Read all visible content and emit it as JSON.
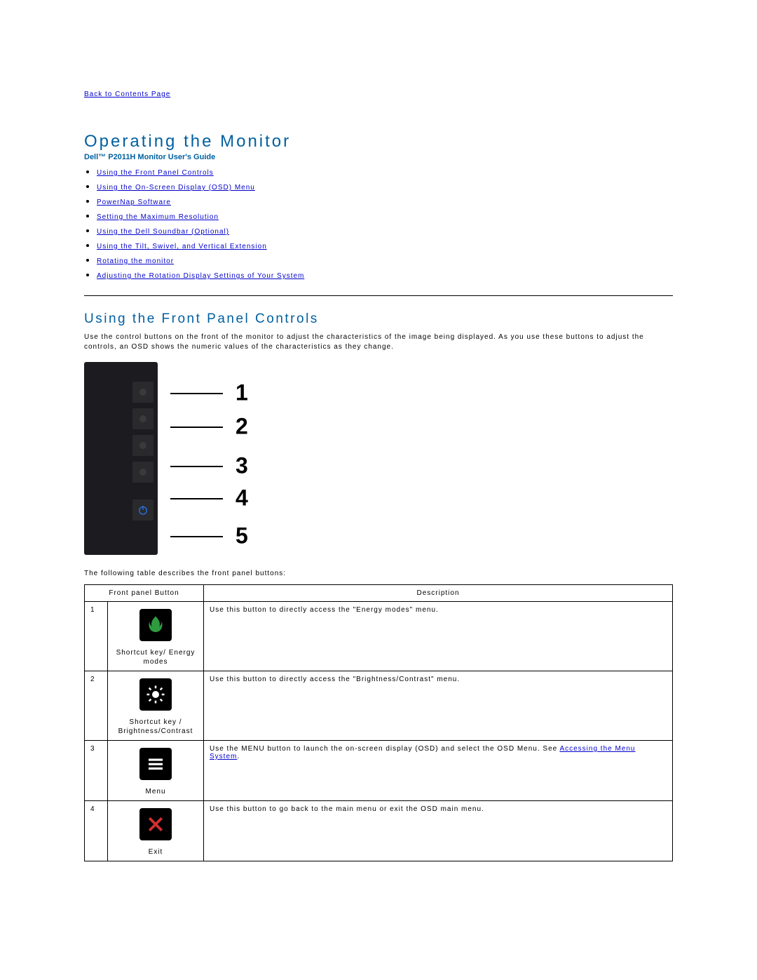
{
  "top_link": "Back to Contents Page",
  "title": "Operating the Monitor",
  "subtitle": "Dell™ P2011H Monitor User's Guide",
  "toc": [
    "Using the Front Panel Controls",
    "Using the On-Screen Display (OSD) Menu",
    "PowerNap Software",
    "Setting the Maximum Resolution",
    "Using the Dell Soundbar (Optional)",
    "Using the Tilt, Swivel, and Vertical Extension",
    "Rotating the monitor",
    "Adjusting the Rotation Display Settings of Your System"
  ],
  "section_heading": "Using the Front Panel Controls",
  "intro_text": "Use the control buttons on the front of the monitor to adjust the characteristics of the image being displayed. As you use these buttons to adjust the controls, an OSD shows the numeric values of the characteristics as they change.",
  "diagram_numbers": [
    "1",
    "2",
    "3",
    "4",
    "5"
  ],
  "table_intro": "The following table describes the front panel buttons:",
  "table": {
    "headers": {
      "col1": "Front panel Button",
      "col2": "Description"
    },
    "rows": [
      {
        "num": "1",
        "label": "Shortcut key/ Energy modes",
        "desc": "Use this button to directly access the \"Energy modes\" menu."
      },
      {
        "num": "2",
        "label": "Shortcut key / Brightness/Contrast",
        "desc": "Use this button to directly access the \"Brightness/Contrast\" menu."
      },
      {
        "num": "3",
        "label": "Menu",
        "desc_pre": "Use the MENU button to launch the on-screen display (OSD) and select the OSD Menu. See ",
        "desc_link": "Accessing the Menu System",
        "desc_post": "."
      },
      {
        "num": "4",
        "label": "Exit",
        "desc": "Use this button to go back to the main menu or exit the OSD main menu."
      }
    ]
  }
}
